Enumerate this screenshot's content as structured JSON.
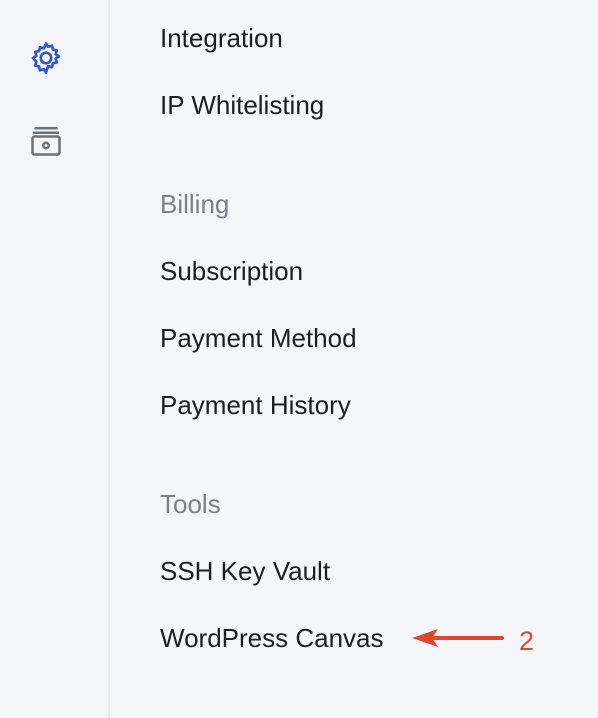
{
  "rail": {
    "icons": [
      "gear-icon",
      "vault-icon"
    ],
    "accent_color": "#3558c8",
    "muted_color": "#6b7280"
  },
  "menu": {
    "items": [
      {
        "label": "Integration"
      },
      {
        "label": "IP Whitelisting"
      },
      {
        "label": "Billing"
      },
      {
        "label": "Subscription"
      },
      {
        "label": "Payment Method"
      },
      {
        "label": "Payment History"
      },
      {
        "label": "Tools"
      },
      {
        "label": "SSH Key Vault"
      },
      {
        "label": "WordPress Canvas"
      }
    ]
  },
  "annotation": {
    "number": "2",
    "color": "#e2452a"
  }
}
